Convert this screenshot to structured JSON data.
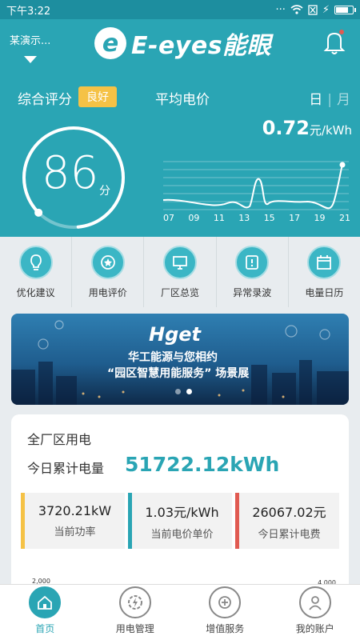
{
  "status_bar": {
    "time": "下午3:22"
  },
  "app": {
    "logo_text": "E-eyes能眼",
    "demo_select": "某演示..."
  },
  "score": {
    "label": "综合评分",
    "grade": "良好",
    "value": "86",
    "unit": "分",
    "gauge_fraction": 0.86
  },
  "price": {
    "label": "平均电价",
    "toggle_day": "日",
    "toggle_separator": "|",
    "toggle_month": "月",
    "value": "0.72",
    "unit": "元/kWh"
  },
  "trend_chart": {
    "x_ticks": [
      "07",
      "09",
      "11",
      "13",
      "15",
      "17",
      "19",
      "21"
    ]
  },
  "quick_actions": [
    {
      "label": "优化建议",
      "icon": "lightbulb-icon"
    },
    {
      "label": "用电评价",
      "icon": "rating-icon"
    },
    {
      "label": "厂区总览",
      "icon": "monitor-icon"
    },
    {
      "label": "异常录波",
      "icon": "alert-icon"
    },
    {
      "label": "电量日历",
      "icon": "calendar-icon"
    }
  ],
  "banner": {
    "brand": "Hget",
    "line1": "华工能源与您相约",
    "line2": "“园区智慧用能服务” 场景展"
  },
  "summary": {
    "title": "全厂区用电",
    "today_label": "今日累计电量",
    "today_value": "51722.12kWh",
    "stats": [
      {
        "value": "3720.21kW",
        "label": "当前功率"
      },
      {
        "value": "1.03元/kWh",
        "label": "当前电价单价"
      },
      {
        "value": "26067.02元",
        "label": "今日累计电费"
      }
    ],
    "axis_left": "2,000",
    "axis_right": "4,000"
  },
  "tabs": [
    {
      "label": "首页",
      "icon": "home-icon",
      "active": true
    },
    {
      "label": "用电管理",
      "icon": "gear-bolt-icon"
    },
    {
      "label": "增值服务",
      "icon": "plus-circle-icon"
    },
    {
      "label": "我的账户",
      "icon": "user-icon"
    }
  ],
  "colors": {
    "primary": "#2aa5b4",
    "badge": "#f5c246",
    "stat_yellow": "#f5c246",
    "stat_teal": "#2aa5b4",
    "stat_red": "#e15b52"
  }
}
